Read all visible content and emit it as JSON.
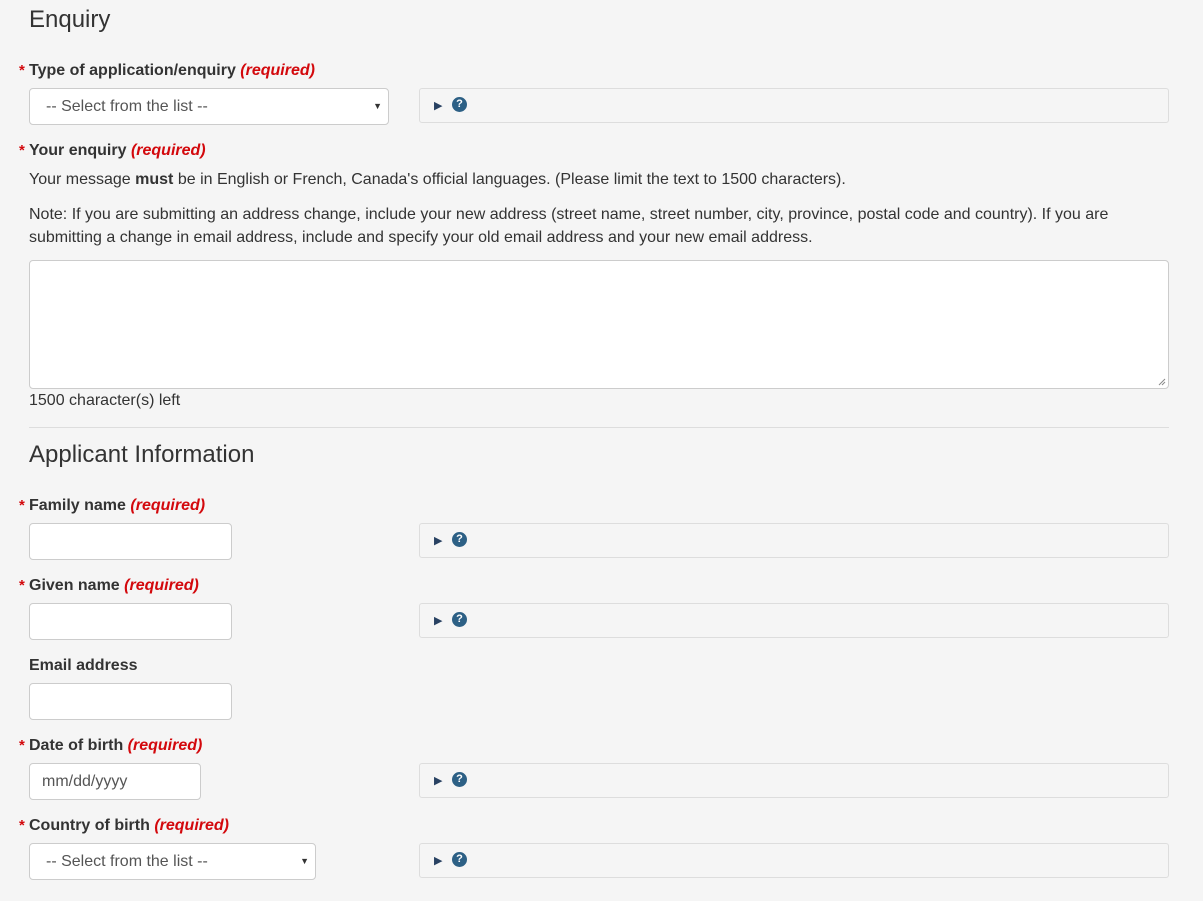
{
  "enquiry": {
    "title": "Enquiry",
    "type": {
      "label": "Type of application/enquiry",
      "required": "(required)",
      "select_value": "-- Select from the list --"
    },
    "your_enquiry": {
      "label": "Your enquiry",
      "required": "(required)",
      "note1_pre": "Your message ",
      "note1_bold": "must",
      "note1_post": " be in English or French, Canada's official languages. (Please limit the text to 1500 characters).",
      "note2": "Note: If you are submitting an address change, include your new address (street name, street number, city, province, postal code and country). If you are submitting a change in email address, include and specify your old email address and your new email address.",
      "value": "",
      "counter": "1500 character(s) left"
    }
  },
  "applicant": {
    "title": "Applicant Information",
    "family_name": {
      "label": "Family name",
      "required": "(required)",
      "value": ""
    },
    "given_name": {
      "label": "Given name",
      "required": "(required)",
      "value": ""
    },
    "email": {
      "label": "Email address",
      "value": ""
    },
    "dob": {
      "label": "Date of birth",
      "required": "(required)",
      "placeholder": "mm/dd/yyyy"
    },
    "country_of_birth": {
      "label": "Country of birth",
      "required": "(required)",
      "select_value": "-- Select from the list --"
    }
  },
  "help": {
    "arrow": "▶",
    "question": "?"
  },
  "icons": {
    "caret": "▼",
    "required_marker": "*"
  },
  "colors": {
    "required": "#d3080c",
    "help_icon": "#2d6085",
    "background": "#f5f5f5"
  }
}
